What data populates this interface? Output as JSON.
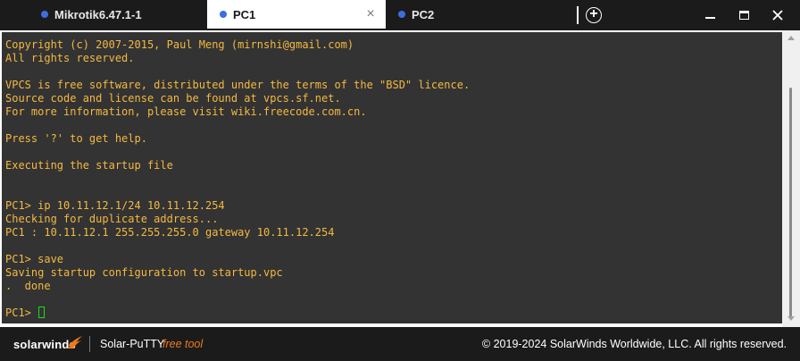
{
  "tabs": [
    {
      "label": "Mikrotik6.47.1-1",
      "dot_color": "#3b6fe0",
      "active": false
    },
    {
      "label": "PC1",
      "dot_color": "#3b6fe0",
      "active": true,
      "close": "×"
    },
    {
      "label": "PC2",
      "dot_color": "#3b6fe0",
      "active": false
    }
  ],
  "window": {
    "add_tab": "+"
  },
  "terminal": {
    "text_color": "#f5b940",
    "background": "#333333",
    "lines": [
      "Copyright (c) 2007-2015, Paul Meng (mirnshi@gmail.com)",
      "All rights reserved.",
      "",
      "VPCS is free software, distributed under the terms of the \"BSD\" licence.",
      "Source code and license can be found at vpcs.sf.net.",
      "For more information, please visit wiki.freecode.com.cn.",
      "",
      "Press '?' to get help.",
      "",
      "Executing the startup file",
      "",
      "",
      "PC1> ip 10.11.12.1/24 10.11.12.254",
      "Checking for duplicate address...",
      "PC1 : 10.11.12.1 255.255.255.0 gateway 10.11.12.254",
      "",
      "PC1> save",
      "Saving startup configuration to startup.vpc",
      ".  done",
      ""
    ],
    "prompt": "PC1> "
  },
  "footer": {
    "brand": "solarwinds",
    "product": "Solar-PuTTY",
    "free_tool": "free tool",
    "copyright": "© 2019-2024 SolarWinds Worldwide, LLC. All rights reserved.",
    "accent": "#f07a1a"
  }
}
